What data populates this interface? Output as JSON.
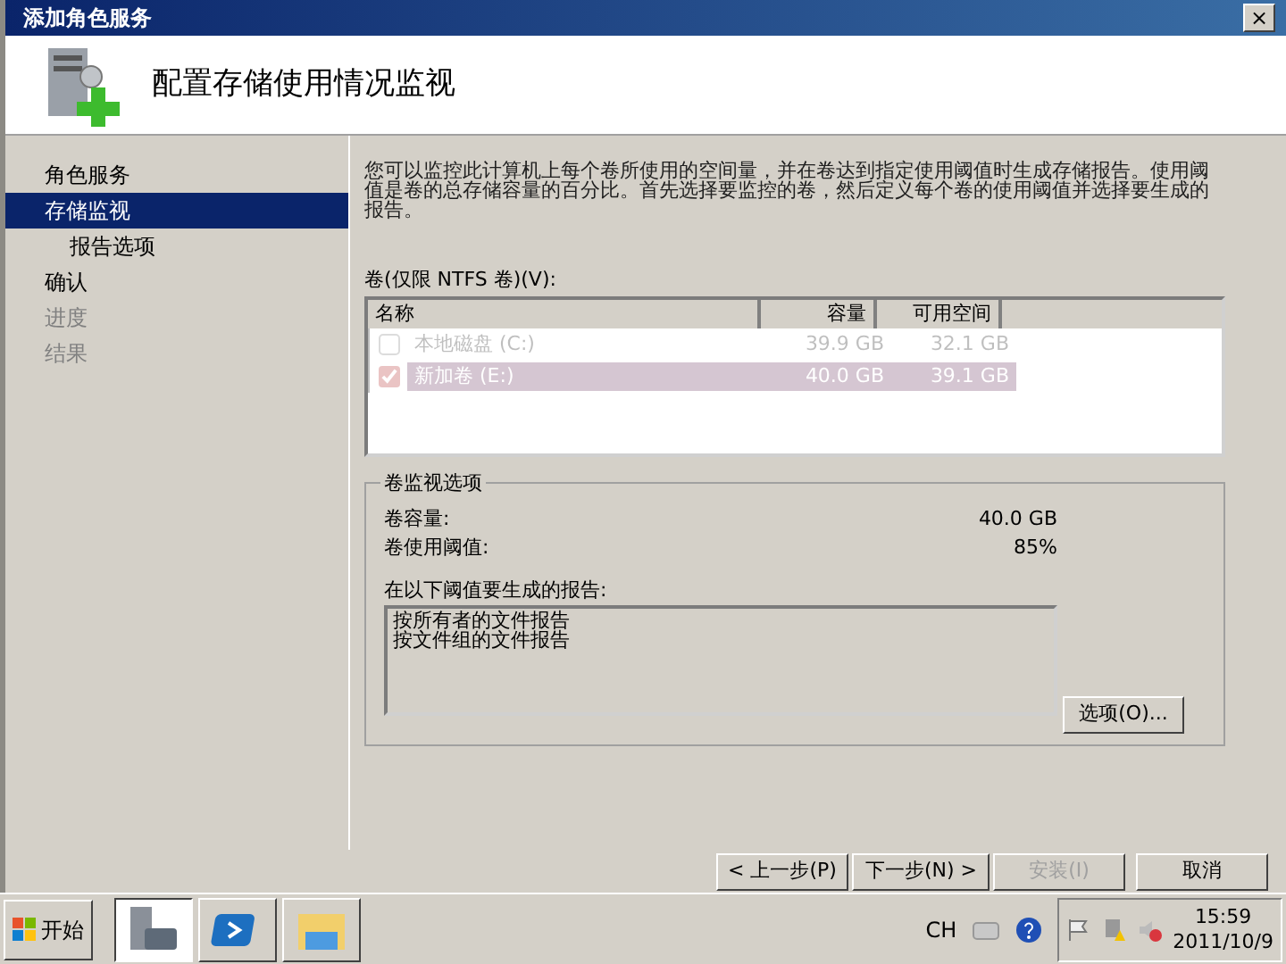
{
  "window": {
    "title": "添加角色服务",
    "close": "×"
  },
  "header": {
    "title": "配置存储使用情况监视"
  },
  "nav": [
    {
      "label": "角色服务",
      "selected": false,
      "disabled": false
    },
    {
      "label": "存储监视",
      "selected": true,
      "disabled": false,
      "children": [
        {
          "label": "报告选项",
          "selected": false,
          "disabled": false
        }
      ]
    },
    {
      "label": "确认",
      "selected": false,
      "disabled": false
    },
    {
      "label": "进度",
      "selected": false,
      "disabled": true
    },
    {
      "label": "结果",
      "selected": false,
      "disabled": true
    }
  ],
  "description": "您可以监控此计算机上每个卷所使用的空间量，并在卷达到指定使用阈值时生成存储报告。使用阈值是卷的总存储容量的百分比。首先选择要监控的卷，然后定义每个卷的使用阈值并选择要生成的报告。",
  "volumes": {
    "label": "卷(仅限 NTFS 卷)(V):",
    "columns": [
      "名称",
      "容量",
      "可用空间"
    ],
    "rows": [
      {
        "name": "本地磁盘 (C:)",
        "capacity": "39.9 GB",
        "free": "32.1 GB",
        "checked": false,
        "selected": false
      },
      {
        "name": "新加卷 (E:)",
        "capacity": "40.0 GB",
        "free": "39.1 GB",
        "checked": true,
        "selected": true
      }
    ]
  },
  "options": {
    "title": "卷监视选项",
    "fields": [
      {
        "label": "卷容量:",
        "value": "40.0 GB"
      },
      {
        "label": "卷使用阈值:",
        "value": "85%"
      }
    ],
    "reports_label": "在以下阈值要生成的报告:",
    "reports": [
      "按所有者的文件报告",
      "按文件组的文件报告"
    ],
    "button": "选项(O)..."
  },
  "buttons": [
    {
      "label": "< 上一步(P)",
      "disabled": false
    },
    {
      "label": "下一步(N) >",
      "disabled": false
    },
    {
      "label": "安装(I)",
      "disabled": true
    },
    {
      "label": "取消",
      "disabled": false
    }
  ],
  "taskbar": {
    "start": "开始",
    "apps": [
      {
        "kind": "server",
        "selected": true
      },
      {
        "kind": "shell",
        "selected": false
      },
      {
        "kind": "folder",
        "selected": false
      }
    ],
    "language": "CH",
    "time": "15:59",
    "date": "2011/10/9"
  }
}
